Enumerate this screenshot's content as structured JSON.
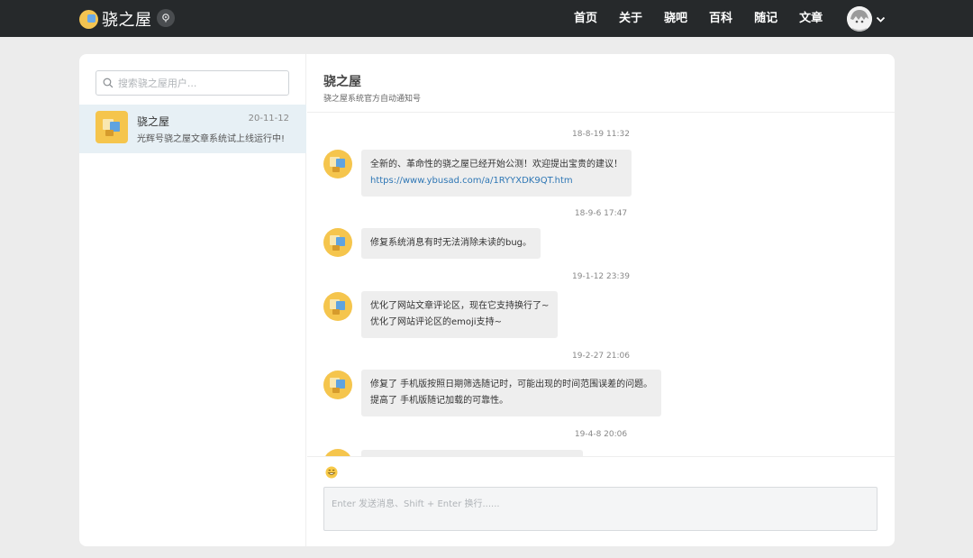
{
  "navbar": {
    "brand_name": "骁之屋",
    "links": [
      "首页",
      "关于",
      "骁吧",
      "百科",
      "随记",
      "文章"
    ]
  },
  "sidebar": {
    "search_placeholder": "搜索骁之屋用户...",
    "contacts": [
      {
        "name": "骁之屋",
        "date": "20-11-12",
        "preview": "光辉号骁之屋文章系统试上线运行中!"
      }
    ]
  },
  "chat": {
    "title": "骁之屋",
    "subtitle": "骁之屋系统官方自动通知号",
    "messages": [
      {
        "time": "18-8-19 11:32",
        "line1": "全新的、革命性的骁之屋已经开始公测！欢迎提出宝贵的建议！",
        "line2": "https://www.ybusad.com/a/1RYYXDK9QT.htm"
      },
      {
        "time": "18-9-6 17:47",
        "line1": "修复系统消息有时无法消除未读的bug。"
      },
      {
        "time": "19-1-12 23:39",
        "line1": "优化了网站文章评论区，现在它支持换行了~",
        "line2": "优化了网站评论区的emoji支持~"
      },
      {
        "time": "19-2-27 21:06",
        "line1": "修复了 手机版按照日期筛选随记时，可能出现的时间范围误差的问题。",
        "line2": "提高了 手机版随记加载的可靠性。"
      },
      {
        "time": "19-4-8 20:06"
      }
    ]
  },
  "composer": {
    "placeholder": "Enter 发送消息、Shift + Enter 换行......",
    "emoji_icon": "smile-emoji-icon"
  },
  "colors": {
    "navbar_bg": "#26292b",
    "page_bg": "#ececec",
    "selected_contact_bg": "#e7f0f5",
    "bubble_bg": "#eeeeee",
    "link": "#2f77b5"
  }
}
